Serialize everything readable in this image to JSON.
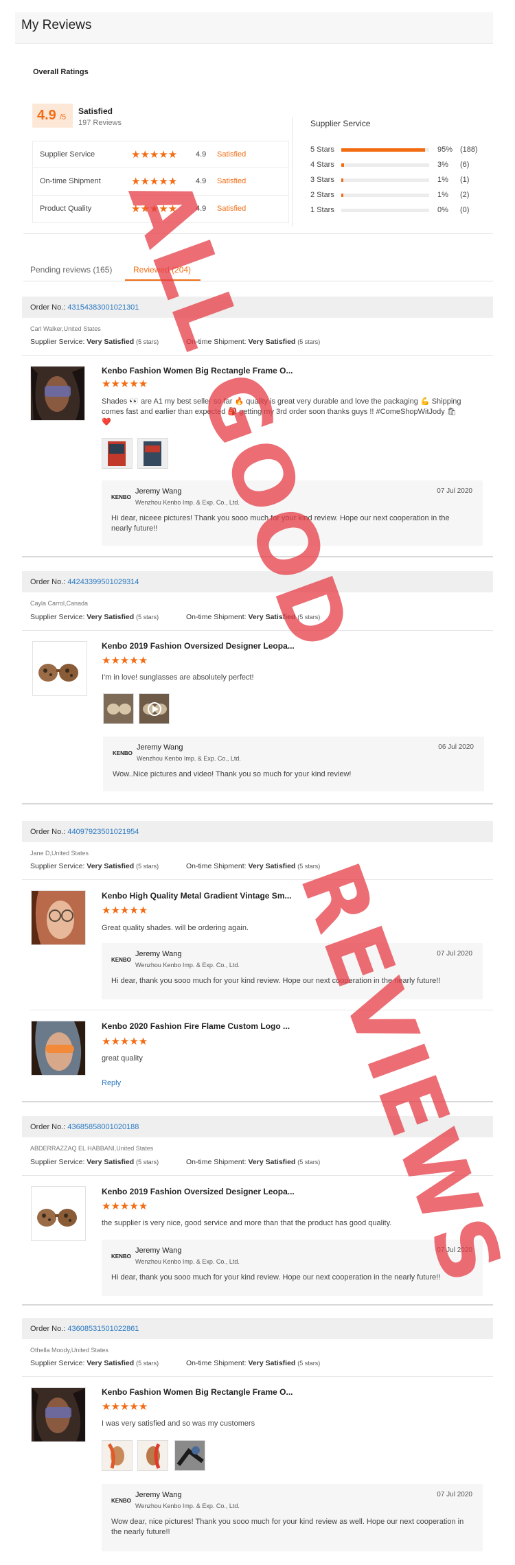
{
  "page": {
    "title": "My Reviews"
  },
  "overall": {
    "title": "Overall Ratings",
    "score": "4.9",
    "score_max": "/5",
    "label": "Satisfied",
    "review_count": "197 Reviews",
    "rows": [
      {
        "name": "Supplier Service",
        "stars": "★★★★★",
        "value": "4.9",
        "status": "Satisfied"
      },
      {
        "name": "On-time Shipment",
        "stars": "★★★★★",
        "value": "4.9",
        "status": "Satisfied"
      },
      {
        "name": "Product Quality",
        "stars": "★★★★★",
        "value": "4.9",
        "status": "Satisfied"
      }
    ]
  },
  "supplier_service": {
    "title": "Supplier Service",
    "dist": [
      {
        "label": "5 Stars",
        "pct": "95%",
        "count": "(188)",
        "frac": 0.95
      },
      {
        "label": "4 Stars",
        "pct": "3%",
        "count": "(6)",
        "frac": 0.03
      },
      {
        "label": "3 Stars",
        "pct": "1%",
        "count": "(1)",
        "frac": 0.01
      },
      {
        "label": "2 Stars",
        "pct": "1%",
        "count": "(2)",
        "frac": 0.01
      },
      {
        "label": "1 Stars",
        "pct": "0%",
        "count": "(0)",
        "frac": 0.0
      }
    ]
  },
  "tabs": [
    {
      "label": "Pending reviews (165)"
    },
    {
      "label": "Reviewed (204)"
    }
  ],
  "labels": {
    "order_no": "Order No.:",
    "supplier_service": "Supplier Service:",
    "ontime": "On-time Shipment:",
    "very_satisfied": "Very Satisfied",
    "five_stars": "(5 stars)",
    "reply": "Reply",
    "stars": "★★★★★",
    "logo": "KENBO"
  },
  "orders": [
    {
      "order_no": "43154383001021301",
      "customer": "Carl Walker,United States",
      "products": [
        {
          "title": "Kenbo Fashion Women Big Rectangle Frame O...",
          "text": "Shades 👀 are A1 my best seller so far 🔥 quality is great very durable and love the packaging 💪 Shipping comes fast and earlier than expected 🎒 getting my 3rd order soon thanks guys !! #ComeShopWitJody 🛍 ❤️"
        }
      ],
      "reply": {
        "name": "Jeremy Wang",
        "company": "Wenzhou Kenbo Imp. & Exp. Co., Ltd.",
        "date": "07 Jul 2020",
        "text": "Hi dear, niceee pictures!  Thank you sooo much for your kind review. Hope our next cooperation in the nearly future!!"
      }
    },
    {
      "order_no": "44243399501029314",
      "customer": "Cayla Carrol,Canada",
      "products": [
        {
          "title": "Kenbo 2019 Fashion Oversized Designer Leopa...",
          "text": "I'm in love! sunglasses are absolutely perfect!"
        }
      ],
      "reply": {
        "name": "Jeremy Wang",
        "company": "Wenzhou Kenbo Imp. & Exp. Co., Ltd.",
        "date": "06 Jul 2020",
        "text": "Wow..Nice pictures and video!  Thank you so much for your kind review!"
      }
    },
    {
      "order_no": "44097923501021954",
      "customer": "Jane D,United States",
      "products": [
        {
          "title": "Kenbo High Quality Metal Gradient Vintage Sm...",
          "text": "Great quality shades. will be ordering again."
        },
        {
          "title": "Kenbo 2020 Fashion Fire Flame Custom Logo ...",
          "text": "great quality"
        }
      ],
      "reply": {
        "name": "Jeremy Wang",
        "company": "Wenzhou Kenbo Imp. & Exp. Co., Ltd.",
        "date": "07 Jul 2020",
        "text": "Hi dear, thank you sooo much for your kind review. Hope our next cooperation in the nearly future!!"
      }
    },
    {
      "order_no": "43685858001020188",
      "customer": "ABDERRAZZAQ EL HABBANI,United States",
      "products": [
        {
          "title": "Kenbo 2019 Fashion Oversized Designer Leopa...",
          "text": "the supplier is very nice, good service and more than that the product has good quality."
        }
      ],
      "reply": {
        "name": "Jeremy Wang",
        "company": "Wenzhou Kenbo Imp. & Exp. Co., Ltd.",
        "date": "07 Jul 2020",
        "text": "Hi dear, thank you sooo much for your kind review. Hope our next cooperation in the nearly future!!"
      }
    },
    {
      "order_no": "43608531501022861",
      "customer": "Othella Moody,United States",
      "products": [
        {
          "title": "Kenbo Fashion Women Big Rectangle Frame O...",
          "text": "I was very satisfied and so was my customers"
        }
      ],
      "reply": {
        "name": "Jeremy Wang",
        "company": "Wenzhou Kenbo Imp. & Exp. Co., Ltd.",
        "date": "07 Jul 2020",
        "text": "Wow dear, nice pictures! Thank you sooo much for your kind review as well. Hope our next cooperation in the nearly future!!"
      }
    }
  ],
  "watermark": {
    "line1": "ALL GOOD",
    "line2": "REVIEWS",
    "color": "#e63c46"
  }
}
